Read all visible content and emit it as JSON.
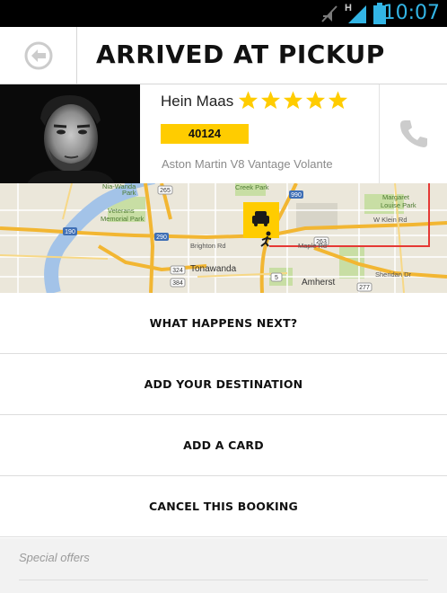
{
  "status_bar": {
    "time": "10:07",
    "network_type": "H",
    "icons": [
      "mute-icon",
      "signal-icon",
      "battery-icon"
    ]
  },
  "header": {
    "title": "ARRIVED AT PICKUP",
    "back_icon": "back-arrow-icon"
  },
  "driver": {
    "name": "Hein Maas",
    "rating": 5,
    "rating_max": 5,
    "plate": "40124",
    "car": "Aston Martin V8 Vantage Volante",
    "call_icon": "phone-icon"
  },
  "map": {
    "labels": {
      "nia_wanda": "Nia-Wanda",
      "park": "Park",
      "veterans": "Veterans",
      "memorial_park": "Memorial Park",
      "creek_park": "Creek Park",
      "margaret": "Margaret",
      "louise_park": "Louise Park",
      "tonawanda": "Tonawanda",
      "amherst": "Amherst",
      "brighton_rd": "Brighton Rd",
      "w_klein_rd": "W Klein Rd",
      "maple_rd": "Maple Rd",
      "sheridan_dr": "Sheridan Dr",
      "r_265": "265",
      "r_190": "190",
      "r_290": "290",
      "r_990": "990",
      "r_324": "324",
      "r_384": "384",
      "r_277": "277",
      "r_263": "263",
      "r_5": "5"
    },
    "marker_icon": "taxi-icon",
    "pickup_icon": "pedestrian-icon",
    "colors": {
      "highway": "#f2b632",
      "water": "#a3c3e8",
      "park": "#c8dea4",
      "route": "#e53935",
      "marker": "#ffcc00"
    }
  },
  "actions": [
    {
      "label": "WHAT HAPPENS NEXT?"
    },
    {
      "label": "ADD YOUR DESTINATION"
    },
    {
      "label": "ADD A CARD"
    },
    {
      "label": "CANCEL THIS BOOKING"
    }
  ],
  "offers": {
    "label": "Special offers"
  },
  "colors": {
    "accent": "#ffcc00",
    "status_blue": "#33b5e5"
  }
}
